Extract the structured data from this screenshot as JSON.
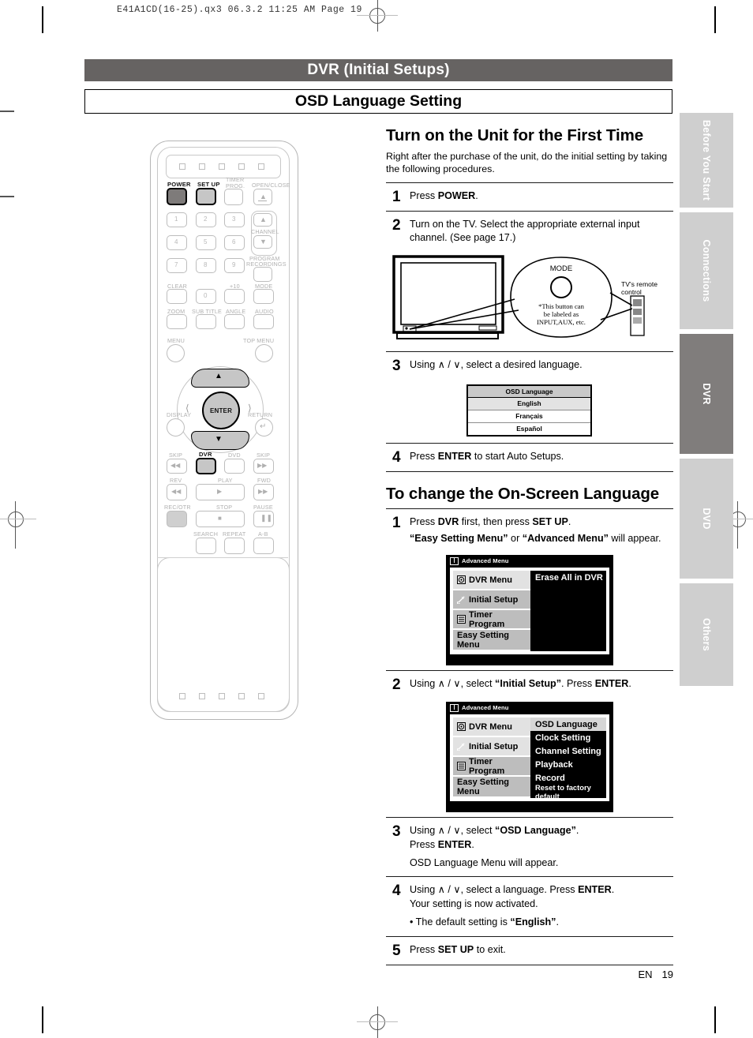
{
  "print_header": "E41A1CD(16-25).qx3   06.3.2 11:25 AM   Page 19",
  "header": {
    "title_bar": "DVR (Initial Setups)",
    "sub_bar": "OSD Language Setting",
    "title_bar_color": "#666362"
  },
  "sidebar": {
    "tabs": [
      {
        "label": "Before You Start",
        "active": false
      },
      {
        "label": "Connections",
        "active": false
      },
      {
        "label": "DVR",
        "active": true
      },
      {
        "label": "DVD",
        "active": false
      },
      {
        "label": "Others",
        "active": false
      }
    ],
    "active_color": "#807d7c",
    "inactive_color": "#cfcfcf"
  },
  "remote": {
    "buttons": [
      {
        "label": "POWER"
      },
      {
        "label": "SET UP"
      },
      {
        "label": "TIMER PROG."
      },
      {
        "label": "OPEN/CLOSE"
      },
      {
        "label": "CHANNEL"
      },
      {
        "label": "PROGRAM RECORDINGS"
      },
      {
        "label": "CLEAR"
      },
      {
        "label": "+10"
      },
      {
        "label": "MODE"
      },
      {
        "label": "ZOOM"
      },
      {
        "label": "SUB TITLE"
      },
      {
        "label": "ANGLE"
      },
      {
        "label": "AUDIO"
      },
      {
        "label": "MENU"
      },
      {
        "label": "TOP MENU"
      },
      {
        "label": "ENTER"
      },
      {
        "label": "DISPLAY"
      },
      {
        "label": "RETURN"
      },
      {
        "label": "SKIP"
      },
      {
        "label": "DVR"
      },
      {
        "label": "DVD"
      },
      {
        "label": "REV"
      },
      {
        "label": "PLAY"
      },
      {
        "label": "FWD"
      },
      {
        "label": "REC/OTR"
      },
      {
        "label": "STOP"
      },
      {
        "label": "PAUSE"
      },
      {
        "label": "SEARCH"
      },
      {
        "label": "REPEAT"
      },
      {
        "label": "A-B"
      }
    ],
    "labels": {
      "power": "POWER",
      "setup": "SET UP",
      "timer_prog_l1": "TIMER",
      "timer_prog_l2": "PROG.",
      "open_close": "OPEN/CLOSE",
      "channel": "CHANNEL",
      "program": "PROGRAM",
      "recordings": "RECORDINGS",
      "clear": "CLEAR",
      "plus10": "+10",
      "mode": "MODE",
      "zoom": "ZOOM",
      "subtitle": "SUB TITLE",
      "angle": "ANGLE",
      "audio": "AUDIO",
      "menu": "MENU",
      "top_menu": "TOP MENU",
      "enter": "ENTER",
      "display": "DISPLAY",
      "return": "RETURN",
      "skip_left": "SKIP",
      "dvr": "DVR",
      "dvd": "DVD",
      "skip_right": "SKIP",
      "rev": "REV",
      "play": "PLAY",
      "fwd": "FWD",
      "rec_otr": "REC/OTR",
      "stop": "STOP",
      "pause": "PAUSE",
      "search": "SEARCH",
      "repeat": "REPEAT",
      "ab": "A-B",
      "n1": "1",
      "n2": "2",
      "n3": "3",
      "n4": "4",
      "n5": "5",
      "n6": "6",
      "n7": "7",
      "n8": "8",
      "n9": "9",
      "n0": "0"
    },
    "highlighted": [
      "POWER",
      "SET UP",
      "DVR"
    ]
  },
  "section1": {
    "heading": "Turn on the Unit for the First Time",
    "intro": "Right after the purchase of the unit, do the initial setting by taking the following procedures.",
    "steps": [
      {
        "num": "1",
        "text_pre": "Press ",
        "bold": "POWER",
        "text_post": "."
      },
      {
        "num": "2",
        "text_pre": "Turn on the TV.  Select the appropriate external input channel.  (See page 17.)",
        "bold": "",
        "text_post": ""
      },
      {
        "num": "3",
        "text_pre": "Using ",
        "bold": "",
        "text_post": ", select a desired language."
      },
      {
        "num": "4",
        "text_pre": "Press ",
        "bold": "ENTER",
        "text_post": " to start Auto Setups."
      }
    ]
  },
  "tv_figure": {
    "mode_label": "MODE",
    "note_line1": "*This button can",
    "note_line2": "be labeled as",
    "note_line3": "INPUT,AUX,  etc.",
    "remote_label_line1": "TV's remote",
    "remote_label_line2": "control"
  },
  "osd_popup": {
    "title": "OSD Language",
    "items": [
      {
        "label": "English",
        "selected": true
      },
      {
        "label": "Français",
        "selected": false
      },
      {
        "label": "Español",
        "selected": false
      }
    ]
  },
  "section2": {
    "heading": "To change the On-Screen Language",
    "steps": [
      {
        "num": "1",
        "line1_pre": "Press ",
        "line1_b1": "DVR",
        "line1_mid": " first, then press ",
        "line1_b2": "SET UP",
        "line1_post": ".",
        "line2_b1": "“Easy Setting Menu”",
        "line2_mid": " or ",
        "line2_b2": "“Advanced Menu”",
        "line2_post": " will appear."
      },
      {
        "num": "2",
        "pre": "Using ",
        "mid": ", select ",
        "b1": "“Initial Setup”",
        "mid2": ".  Press ",
        "b2": "ENTER",
        "post": "."
      },
      {
        "num": "3",
        "pre": "Using ",
        "mid": ", select ",
        "b1": "“OSD Language”",
        "mid2": ".",
        "line2_pre": "Press ",
        "line2_b": "ENTER",
        "line2_post": ".",
        "line3": "OSD Language Menu will appear."
      },
      {
        "num": "4",
        "pre": "Using ",
        "mid": ", select a language.  Press ",
        "b1": "ENTER",
        "post": ".",
        "line2": "Your setting is now activated.",
        "bullet_pre": "• The default setting is ",
        "bullet_b": "“English”",
        "bullet_post": "."
      },
      {
        "num": "5",
        "pre": "Press ",
        "b1": "SET UP",
        "post": " to exit."
      }
    ]
  },
  "advanced_menu_1": {
    "bar_title": "Advanced Menu",
    "left_items": [
      {
        "label": "DVR Menu",
        "icon": "disc-icon",
        "selected": true
      },
      {
        "label": "Initial Setup",
        "icon": "wrench-icon",
        "selected": false
      },
      {
        "label": "Timer Program",
        "icon": "list-icon",
        "selected": false
      },
      {
        "label": "Easy Setting Menu",
        "icon": "",
        "selected": false
      }
    ],
    "right_items": [
      {
        "label": "Erase All in DVR",
        "selected": false
      },
      {
        "label": "",
        "selected": false
      },
      {
        "label": "",
        "selected": false
      },
      {
        "label": "",
        "selected": false
      },
      {
        "label": "",
        "selected": false
      },
      {
        "label": "",
        "selected": false
      }
    ]
  },
  "advanced_menu_2": {
    "bar_title": "Advanced Menu",
    "left_items": [
      {
        "label": "DVR Menu",
        "icon": "disc-icon",
        "selected": false
      },
      {
        "label": "Initial Setup",
        "icon": "wrench-icon",
        "selected": true
      },
      {
        "label": "Timer Program",
        "icon": "list-icon",
        "selected": false
      },
      {
        "label": "Easy Setting Menu",
        "icon": "",
        "selected": false
      }
    ],
    "right_items": [
      {
        "label": "OSD Language",
        "selected": true
      },
      {
        "label": "Clock Setting",
        "selected": false
      },
      {
        "label": "Channel Setting",
        "selected": false
      },
      {
        "label": "Playback",
        "selected": false
      },
      {
        "label": "Record",
        "selected": false
      },
      {
        "label": "Reset to factory default",
        "selected": false
      }
    ]
  },
  "footer": {
    "lang": "EN",
    "page": "19"
  }
}
